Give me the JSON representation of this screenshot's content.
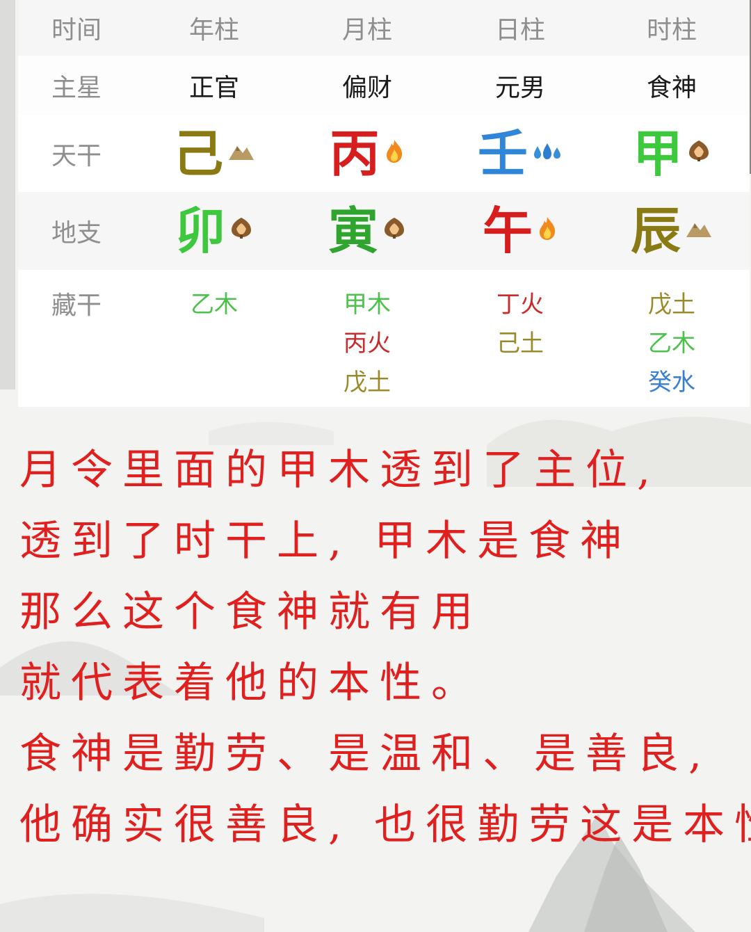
{
  "columns": [
    "时间",
    "年柱",
    "月柱",
    "日柱",
    "时柱"
  ],
  "rows": {
    "zhuxing": {
      "label": "主星",
      "values": [
        "正官",
        "偏财",
        "元男",
        "食神"
      ]
    },
    "tiangan": {
      "label": "天干",
      "chars": [
        {
          "text": "己",
          "color": "#8a7a14",
          "icon": "mountain-icon"
        },
        {
          "text": "丙",
          "color": "#d61e1e",
          "icon": "fire-icon"
        },
        {
          "text": "壬",
          "color": "#2f86d8",
          "icon": "water-drops-icon"
        },
        {
          "text": "甲",
          "color": "#3dc83d",
          "icon": "wood-icon"
        }
      ]
    },
    "dizhi": {
      "label": "地支",
      "chars": [
        {
          "text": "卯",
          "color": "#3dc83d",
          "icon": "wood-icon"
        },
        {
          "text": "寅",
          "color": "#2fa52f",
          "icon": "wood-icon"
        },
        {
          "text": "午",
          "color": "#d61e1e",
          "icon": "fire-icon"
        },
        {
          "text": "辰",
          "color": "#8a7a14",
          "icon": "mountain-icon"
        }
      ]
    },
    "canggan": {
      "label": "藏干",
      "columns": [
        [
          {
            "text": "乙木",
            "color": "#4cc24c"
          }
        ],
        [
          {
            "text": "甲木",
            "color": "#4cc24c"
          },
          {
            "text": "丙火",
            "color": "#c92a2a"
          },
          {
            "text": "戊土",
            "color": "#9a8a2a"
          }
        ],
        [
          {
            "text": "丁火",
            "color": "#c92a2a"
          },
          {
            "text": "己土",
            "color": "#9a8a2a"
          }
        ],
        [
          {
            "text": "戊土",
            "color": "#9a8a2a"
          },
          {
            "text": "乙木",
            "color": "#4cc24c"
          },
          {
            "text": "癸水",
            "color": "#3a7fd0"
          }
        ]
      ]
    }
  },
  "text_lines": [
    "月令里面的甲木透到了主位,",
    "透到了时干上, 甲木是食神",
    "那么这个食神就有用",
    "就代表着他的本性。",
    "食神是勤劳、是温和、是善良,",
    "他确实很善良, 也很勤劳这是本性"
  ],
  "colors": {
    "annotation_text": "#e0201f",
    "label_gray": "#8e8e8e"
  }
}
